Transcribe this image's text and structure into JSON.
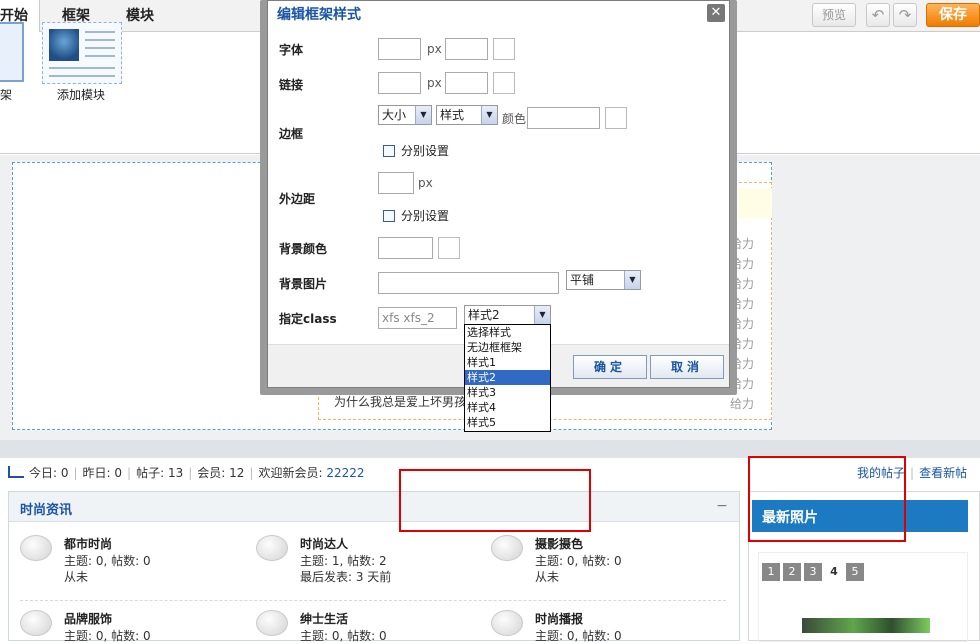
{
  "toolbar": {
    "tabs": [
      "开始",
      "框架",
      "模块"
    ],
    "preview_label": "预览",
    "undo_icon": "↶",
    "redo_icon": "↷",
    "save_label": "保存"
  },
  "ribbon": {
    "frame_label_partial": "架",
    "add_module_label": "添加模块"
  },
  "edit_area": {
    "side_list": [
      "给力",
      "给力",
      "给力",
      "给力",
      "给力",
      "给力",
      "给力",
      "给力",
      "给力"
    ],
    "inner_title": "为什么我总是爱上坏男孩"
  },
  "stats": {
    "today": "今日: 0",
    "yesterday": "昨日: 0",
    "posts": "帖子: 13",
    "members": "会员: 12",
    "welcome": "欢迎新会员:",
    "new_member": "22222",
    "links": [
      "我的帖子",
      "查看新帖"
    ]
  },
  "category": {
    "title": "时尚资讯",
    "collapse_icon": "−",
    "forums": [
      {
        "name": "都市时尚",
        "meta": "主题: 0, 帖数: 0",
        "meta2": "从未"
      },
      {
        "name": "时尚达人",
        "meta": "主题: 1, 帖数: 2",
        "meta2": "最后发表: 3 天前"
      },
      {
        "name": "摄影摄色",
        "meta": "主题: 0, 帖数: 0",
        "meta2": "从未"
      },
      {
        "name": "品牌服饰",
        "meta": "主题: 0, 帖数: 0",
        "meta2": ""
      },
      {
        "name": "绅士生活",
        "meta": "主题: 0, 帖数: 0",
        "meta2": ""
      },
      {
        "name": "时尚播报",
        "meta": "主题: 0, 帖数: 0",
        "meta2": ""
      }
    ]
  },
  "photos": {
    "title": "最新照片",
    "pages": [
      "1",
      "2",
      "3",
      "4",
      "5"
    ],
    "current_page": "4"
  },
  "modal": {
    "title": "编辑框架样式",
    "close_icon": "✕",
    "labels": {
      "font": "字体",
      "link": "链接",
      "border": "边框",
      "margin": "外边距",
      "bg_color": "背景颜色",
      "bg_image": "背景图片",
      "class": "指定class"
    },
    "unit_px": "px",
    "border_size_select": "大小",
    "border_style_select": "样式",
    "border_color_label": "颜色",
    "separate_setting": "分别设置",
    "bg_repeat_select": "平铺",
    "class_input_value": "xfs xfs_2",
    "class_select_value": "样式2",
    "class_options": [
      "选择样式",
      "无边框框架",
      "样式1",
      "样式2",
      "样式3",
      "样式4",
      "样式5"
    ],
    "class_selected_option": "样式2",
    "confirm_label": "确定",
    "cancel_label": "取消"
  }
}
